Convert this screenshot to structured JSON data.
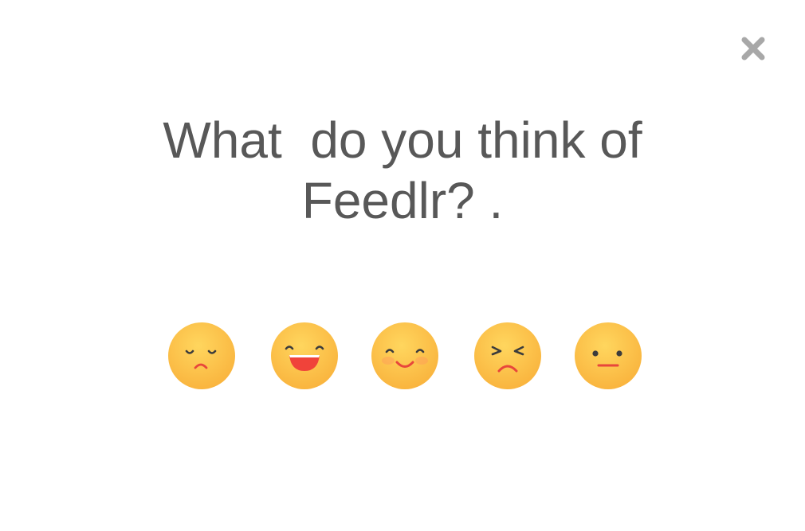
{
  "dialog": {
    "title_line1": "What  do you think of",
    "title_line2": "Feedlr? .",
    "close_icon": "close-icon",
    "face_color": "#FFC84A",
    "close_color": "#A8A8A8",
    "text_color": "#585858"
  },
  "ratings": [
    {
      "icon": "sad-face-icon"
    },
    {
      "icon": "laughing-face-icon"
    },
    {
      "icon": "smiling-face-icon"
    },
    {
      "icon": "angry-face-icon"
    },
    {
      "icon": "neutral-face-icon"
    }
  ]
}
